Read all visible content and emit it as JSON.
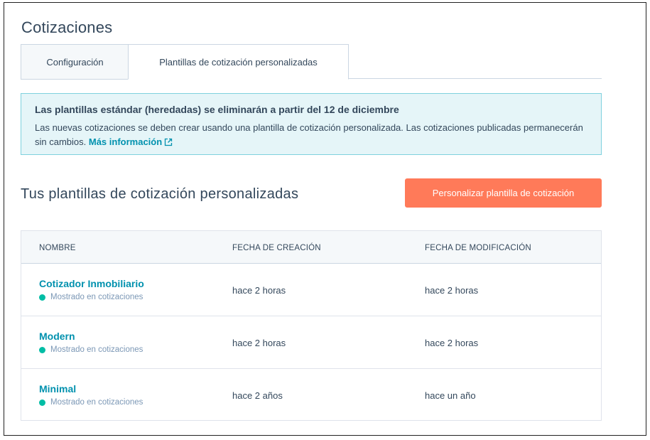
{
  "page": {
    "title": "Cotizaciones"
  },
  "tabs": [
    {
      "label": "Configuración",
      "active": false
    },
    {
      "label": "Plantillas de cotización personalizadas",
      "active": true
    }
  ],
  "alert": {
    "title": "Las plantillas estándar (heredadas) se eliminarán a partir del 12 de diciembre",
    "body": "Las nuevas cotizaciones se deben crear usando una plantilla de cotización personalizada. Las cotizaciones publicadas permanecerán sin cambios.",
    "link_label": "Más información",
    "link_icon": "external-link-icon"
  },
  "section": {
    "title": "Tus plantillas de cotización personalizadas",
    "primary_button": "Personalizar plantilla de cotización"
  },
  "table": {
    "headers": [
      "NOMBRE",
      "FECHA DE CREACIÓN",
      "FECHA DE MODIFICACIÓN"
    ],
    "rows": [
      {
        "name": "Cotizador Inmobiliario",
        "status": "Mostrado en cotizaciones",
        "created": "hace 2 horas",
        "modified": "hace 2 horas"
      },
      {
        "name": "Modern",
        "status": "Mostrado en cotizaciones",
        "created": "hace 2 horas",
        "modified": "hace 2 horas"
      },
      {
        "name": "Minimal",
        "status": "Mostrado en cotizaciones",
        "created": "hace 2 años",
        "modified": "hace un año"
      }
    ]
  },
  "colors": {
    "accent": "#ff7a59",
    "link": "#0091ae",
    "status_dot": "#00bda5",
    "alert_bg": "#e5f5f8",
    "alert_border": "#7fd1de"
  }
}
